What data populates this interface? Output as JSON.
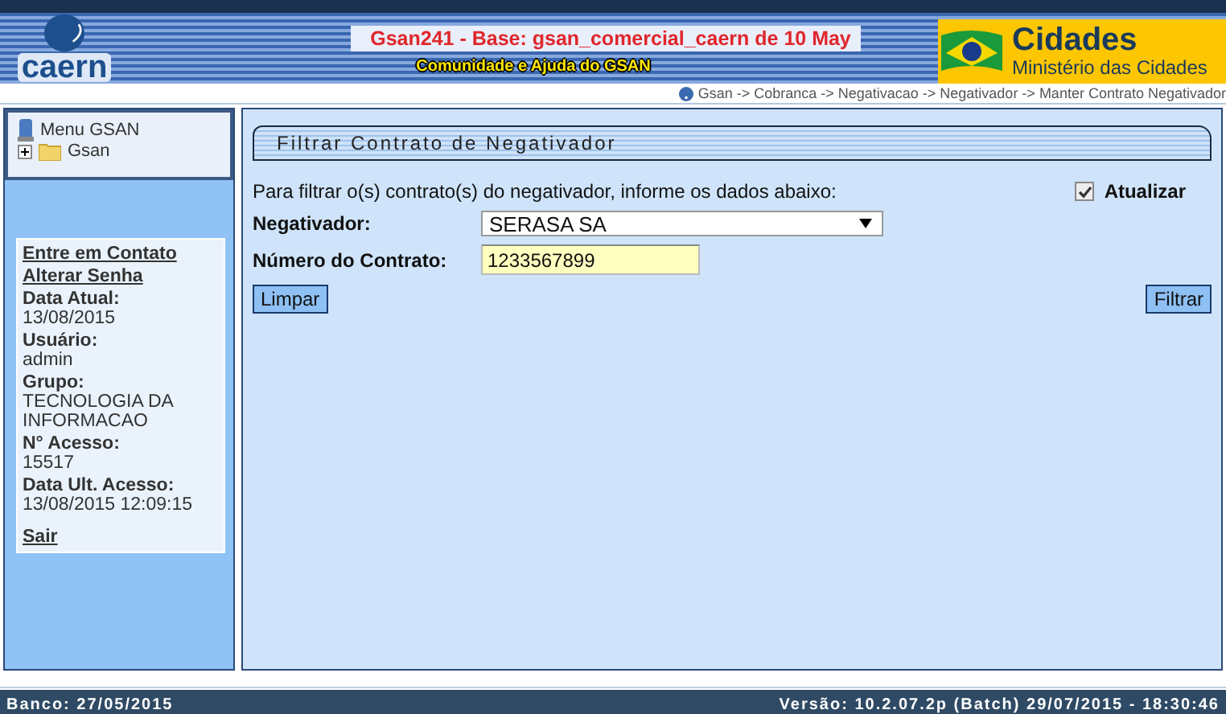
{
  "header": {
    "logo": "caern",
    "title": "Gsan241 - Base: gsan_comercial_caern de 10 May",
    "help_link": "Comunidade e Ajuda do GSAN",
    "ministry": {
      "title": "Cidades",
      "subtitle": "Ministério das Cidades"
    }
  },
  "breadcrumb": "Gsan -> Cobranca -> Negativacao -> Negativador -> Manter Contrato Negativador",
  "menu": {
    "title": "Menu GSAN",
    "tree": [
      {
        "label": "Gsan",
        "expanded": false
      }
    ]
  },
  "user_panel": {
    "links": [
      "Entre em Contato",
      "Alterar Senha"
    ],
    "info": [
      {
        "label": "Data Atual:",
        "value": "13/08/2015"
      },
      {
        "label": "Usuário:",
        "value": "admin"
      },
      {
        "label": "Grupo:",
        "value": "TECNOLOGIA DA INFORMACAO"
      },
      {
        "label": "N° Acesso:",
        "value": "15517"
      },
      {
        "label": "Data Ult. Acesso:",
        "value": "13/08/2015 12:09:15"
      }
    ],
    "logout": "Sair"
  },
  "form": {
    "title": "Filtrar Contrato de Negativador",
    "instructions": "Para filtrar o(s) contrato(s) do negativador, informe os dados abaixo:",
    "update": {
      "label": "Atualizar",
      "checked": true
    },
    "fields": [
      {
        "kind": "select",
        "label": "Negativador:",
        "value": "SERASA SA"
      },
      {
        "kind": "text",
        "label": "Número do Contrato:",
        "value": "1233567899"
      }
    ],
    "clear_button": "Limpar",
    "filter_button": "Filtrar"
  },
  "status_bar": {
    "left": "Banco: 27/05/2015",
    "right": "Versão: 10.2.07.2p (Batch) 29/07/2015 - 18:30:46"
  }
}
